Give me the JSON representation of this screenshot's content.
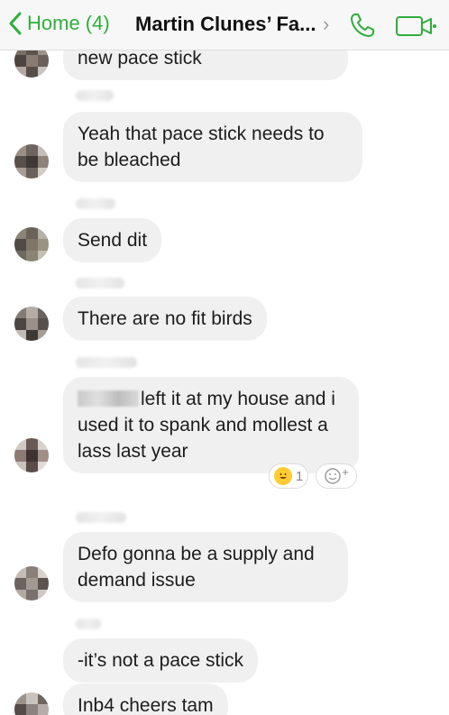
{
  "header": {
    "back_label": "Home (4)",
    "title": "Martin Clunes’ Fa...",
    "chevron": "›"
  },
  "messages": [
    {
      "text": "new pace stick"
    },
    {
      "text": "Yeah that pace stick needs to be bleached"
    },
    {
      "text": "Send dit"
    },
    {
      "text": "There are no fit birds"
    },
    {
      "text": "left it at my house and i used it to spank and mollest a lass last year",
      "reaction_count": "1",
      "add_reaction": "+"
    },
    {
      "text": "Defo gonna be a supply and demand issue"
    },
    {
      "text": "-it’s not a pace stick"
    },
    {
      "text": "Inb4 cheers tam"
    }
  ],
  "colors": {
    "accent": "#2fae3b",
    "bubble": "#f0f0f0"
  },
  "icons": [
    "back-chevron-icon",
    "phone-icon",
    "video-icon",
    "emoji-icon",
    "add-reaction-icon"
  ]
}
